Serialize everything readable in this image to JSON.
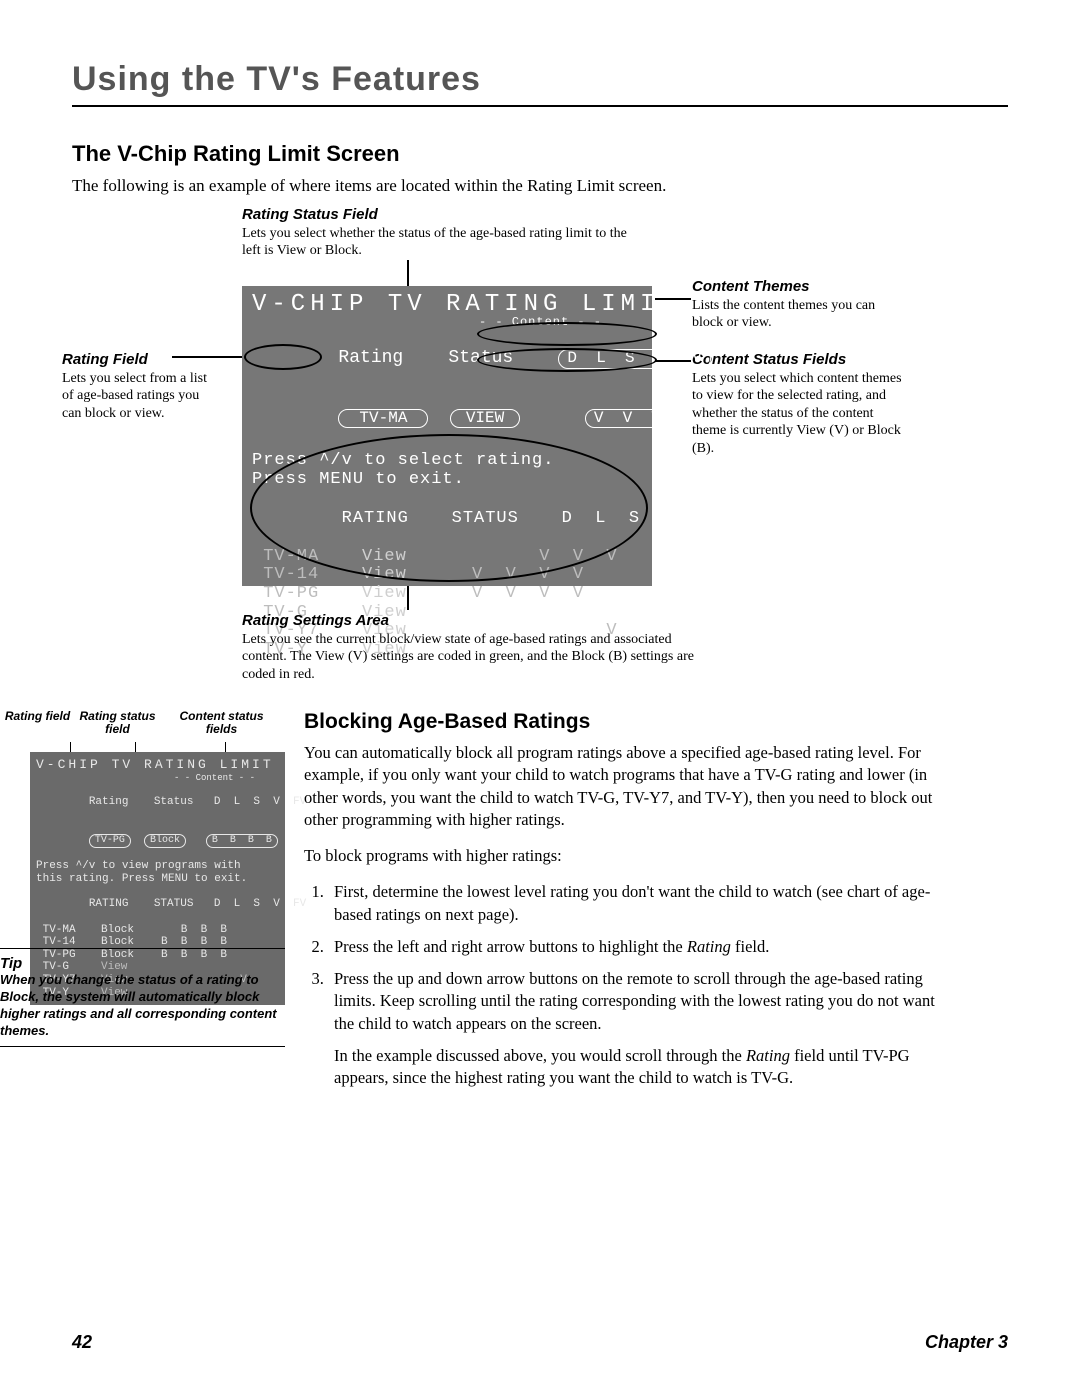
{
  "chapter_title": "Using the TV's Features",
  "section1": {
    "title": "The V-Chip Rating Limit Screen",
    "intro": "The following is an example of where items are located within the Rating Limit screen."
  },
  "callouts": {
    "rating_status_field": {
      "title": "Rating Status Field",
      "text": "Lets you select whether the status of the age-based rating limit to the left is View or Block."
    },
    "rating_field": {
      "title": "Rating Field",
      "text": "Lets you select from a list of age-based ratings you can block or view."
    },
    "content_themes": {
      "title": "Content Themes",
      "text": "Lists the content themes you can block or view."
    },
    "content_status_fields": {
      "title": "Content Status Fields",
      "text": "Lets you select which content themes to view for the selected rating, and whether the status of the content theme is currently View (V) or Block (B)."
    },
    "rating_settings_area": {
      "title": "Rating Settings Area",
      "text": "Lets you see the current block/view state of age-based ratings and associated content. The View (V) settings are coded in green, and the Block (B) settings are coded in red."
    }
  },
  "tv_main": {
    "title": "V-CHIP TV RATING LIMIT",
    "content_label": "- - Content - -",
    "header_row": {
      "rating": "Rating",
      "status": "Status",
      "themes": "D  L  S  V  FV"
    },
    "selected": {
      "rating": "TV-MA",
      "status": "VIEW",
      "themerow": "V  V  V"
    },
    "help1": "Press ^/v to select rating.",
    "help2": "Press MENU to exit.",
    "table_header": {
      "rating": "RATING",
      "status": "STATUS",
      "themes": "D  L  S  V  FV"
    },
    "rows": [
      {
        "rating": "TV-MA",
        "status": "View",
        "themes": "      V  V  V"
      },
      {
        "rating": "TV-14",
        "status": "View",
        "themes": "V  V  V  V"
      },
      {
        "rating": "TV-PG",
        "status": "View",
        "themes": "V  V  V  V"
      },
      {
        "rating": "TV-G",
        "status": "View",
        "themes": ""
      },
      {
        "rating": "TV-Y7",
        "status": "View",
        "themes": "            V"
      },
      {
        "rating": "TV-Y",
        "status": "View",
        "themes": ""
      }
    ]
  },
  "mini_labels": {
    "c1": "Rating field",
    "c2": "Rating status field",
    "c3": "Content status fields"
  },
  "tv_mini": {
    "title": "V-CHIP TV RATING LIMIT",
    "content_label": "- - Content - -",
    "header_row": {
      "rating": "Rating",
      "status": "Status",
      "themes": "D  L  S  V  FV"
    },
    "selected": {
      "rating": "TV-PG",
      "status": "Block",
      "themerow": "B  B  B  B"
    },
    "help1": "Press ^/v to view programs with",
    "help2": "this rating. Press MENU to exit.",
    "table_header": {
      "rating": "RATING",
      "status": "STATUS",
      "themes": "D  L  S  V  FV"
    },
    "rows": [
      {
        "rating": "TV-MA",
        "status": "Block",
        "themes": "   B  B  B"
      },
      {
        "rating": "TV-14",
        "status": "Block",
        "themes": "B  B  B  B"
      },
      {
        "rating": "TV-PG",
        "status": "Block",
        "themes": "B  B  B  B"
      },
      {
        "rating": "TV-G",
        "status": "View",
        "themes": ""
      },
      {
        "rating": "TV-Y7",
        "status": "View",
        "themes": "            V"
      },
      {
        "rating": "TV-Y",
        "status": "View",
        "themes": ""
      }
    ]
  },
  "tip": {
    "head": "Tip",
    "body": "When you change the status of a rating to Block, the system will automatically block higher ratings and all corresponding content themes."
  },
  "section2": {
    "title": "Blocking Age-Based Ratings",
    "p1": "You can automatically block all program ratings above a specified age-based rating level. For example, if you only want your child to watch programs that have a TV-G rating and lower (in other words, you want the child to watch TV-G, TV-Y7, and TV-Y), then you need to block out other programming with higher ratings.",
    "p2": "To block programs with higher ratings:",
    "li1": "First, determine the lowest level rating you don't want the child to watch (see chart of age-based ratings on next page).",
    "li2a": "Press the left and right arrow buttons to highlight the ",
    "li2b": "Rating",
    "li2c": " field.",
    "li3": "Press the up and down arrow buttons on the remote to scroll through the age-based rating limits. Keep scrolling until the rating corresponding with the lowest rating you do not want the child to watch appears on the screen.",
    "li3_example_a": "In the example discussed above, you would scroll through the ",
    "li3_example_b": "Rating",
    "li3_example_c": " field until TV-PG appears, since the highest rating you want the child to watch is TV-G."
  },
  "footer": {
    "page": "42",
    "chapter": "Chapter 3"
  }
}
